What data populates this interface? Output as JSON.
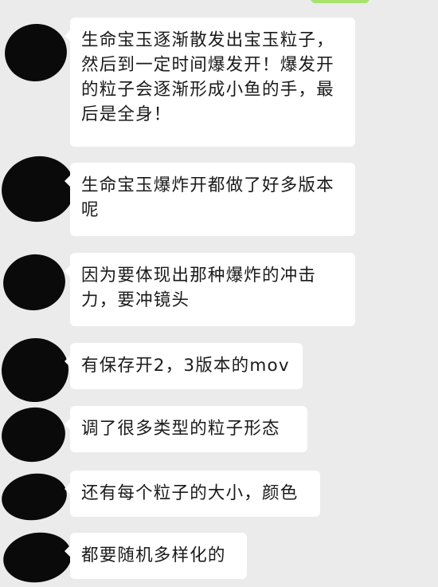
{
  "chat": {
    "messages": [
      {
        "text": "生命宝玉逐渐散发出宝玉粒子，然后到一定时间爆发开！爆发开的粒子会逐渐形成小鱼的手，最后是全身！"
      },
      {
        "text": "生命宝玉爆炸开都做了好多版本呢"
      },
      {
        "text": "因为要体现出那种爆炸的冲击力，要冲镜头"
      },
      {
        "text": "有保存开2，3版本的mov"
      },
      {
        "text": "调了很多类型的粒子形态"
      },
      {
        "text": "还有每个粒子的大小，颜色"
      },
      {
        "text": "都要随机多样化的"
      }
    ]
  }
}
